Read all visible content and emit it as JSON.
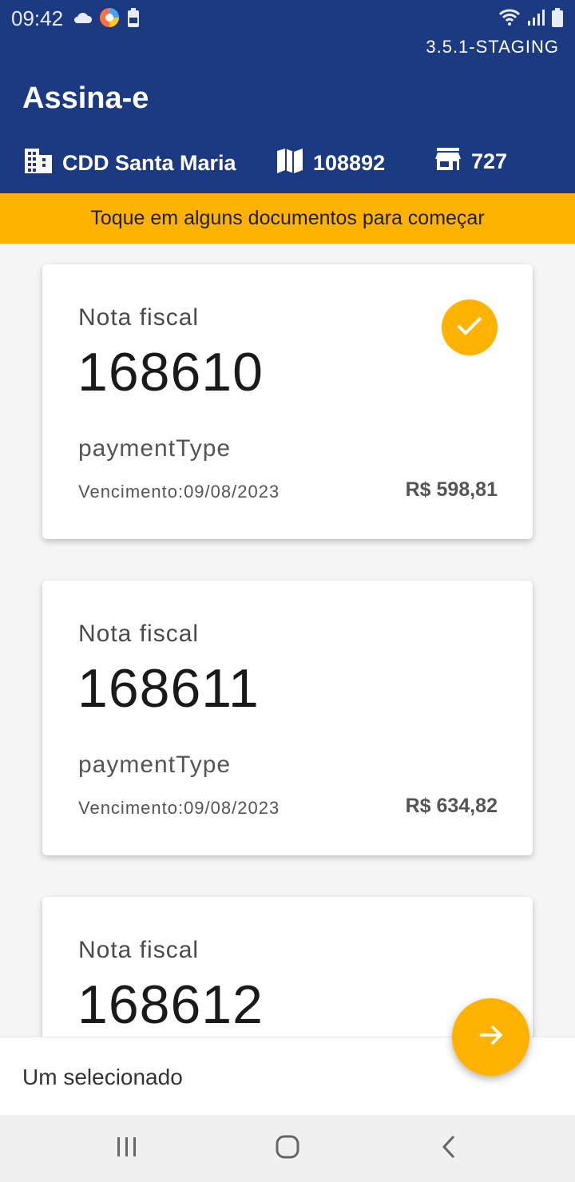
{
  "status_bar": {
    "time": "09:42",
    "left_icons": [
      "cloud-icon",
      "browser-app-icon",
      "battery-saver-icon"
    ],
    "right_icons": [
      "wifi-icon",
      "signal-icon",
      "battery-icon"
    ]
  },
  "header": {
    "version": "3.5.1-STAGING",
    "title": "Assina-e",
    "branch": {
      "icon": "building-icon",
      "label": "CDD Santa Maria"
    },
    "route": {
      "icon": "map-icon",
      "label": "108892"
    },
    "store": {
      "icon": "store-icon",
      "label": "727"
    }
  },
  "banner": {
    "text": "Toque em alguns documentos para começar"
  },
  "documents": [
    {
      "label": "Nota fiscal",
      "number": "168610",
      "payment_type": "paymentType",
      "due": "Vencimento:09/08/2023",
      "amount": "R$ 598,81",
      "selected": true
    },
    {
      "label": "Nota fiscal",
      "number": "168611",
      "payment_type": "paymentType",
      "due": "Vencimento:09/08/2023",
      "amount": "R$ 634,82",
      "selected": false
    },
    {
      "label": "Nota fiscal",
      "number": "168612",
      "selected": false
    }
  ],
  "footer": {
    "selection_text": "Um selecionado"
  },
  "fab": {
    "icon": "arrow-right-icon"
  },
  "nav": {
    "icons": [
      "recent-apps-icon",
      "home-icon",
      "back-icon"
    ]
  },
  "colors": {
    "primary": "#1b3a82",
    "accent": "#ffb300"
  }
}
